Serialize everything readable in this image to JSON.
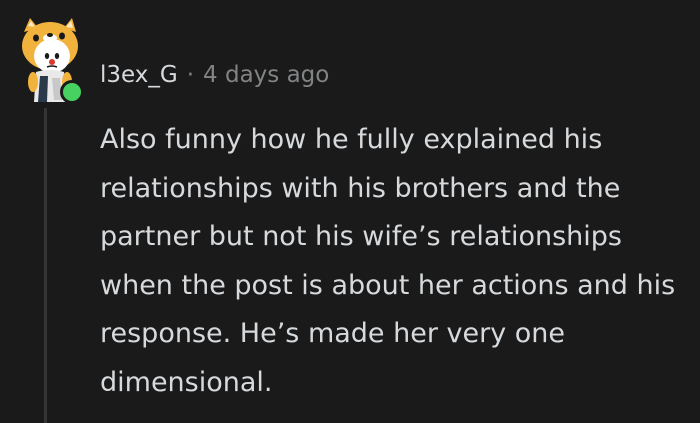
{
  "comment": {
    "username": "l3ex_G",
    "separator": "·",
    "timestamp": "4 days ago",
    "body": "Also funny how he fully explained his relationships with his brothers and the partner but not his wife’s relationships when the post is about her actions and his response. He’s made her very one dimensional."
  },
  "avatar": {
    "icon": "shiba-snoo-avatar-icon",
    "online_indicator_color": "#46d160"
  },
  "colors": {
    "background": "#1a1a1b",
    "text": "#d7dadc",
    "meta": "#818384",
    "thread_line": "#343536"
  }
}
